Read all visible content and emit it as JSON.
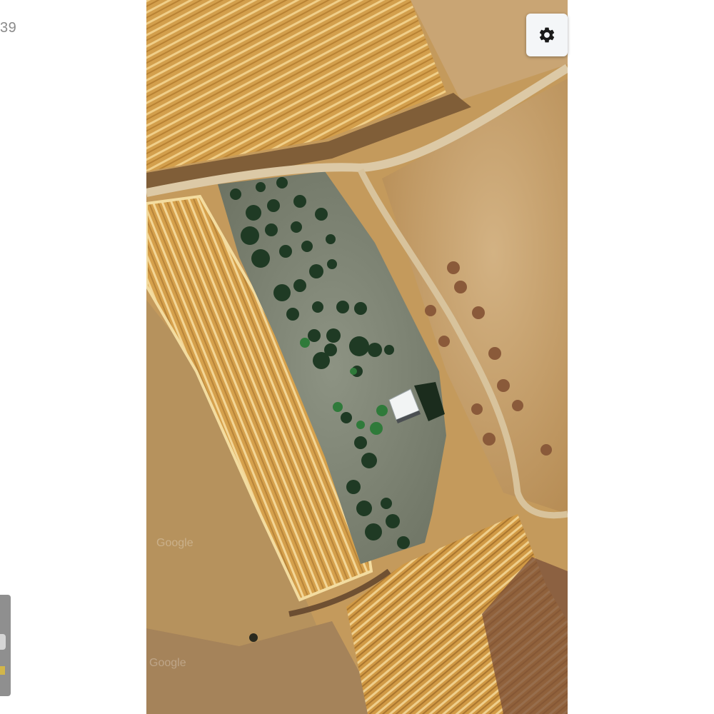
{
  "page": {
    "corner_text": "39"
  },
  "map": {
    "type": "satellite",
    "watermarks": [
      "Google",
      "Google"
    ]
  },
  "controls": {
    "settings": {
      "icon": "gear-icon"
    }
  },
  "colors": {
    "wheat_field": "#d4a24e",
    "dry_field": "#c09b64",
    "plot_ground": "#7e8574",
    "tree_dark": "#1f3a24",
    "tree_green": "#2f7a3a",
    "dirt_road": "#d9c6a4",
    "settings_bg": "#f4f6f8"
  }
}
